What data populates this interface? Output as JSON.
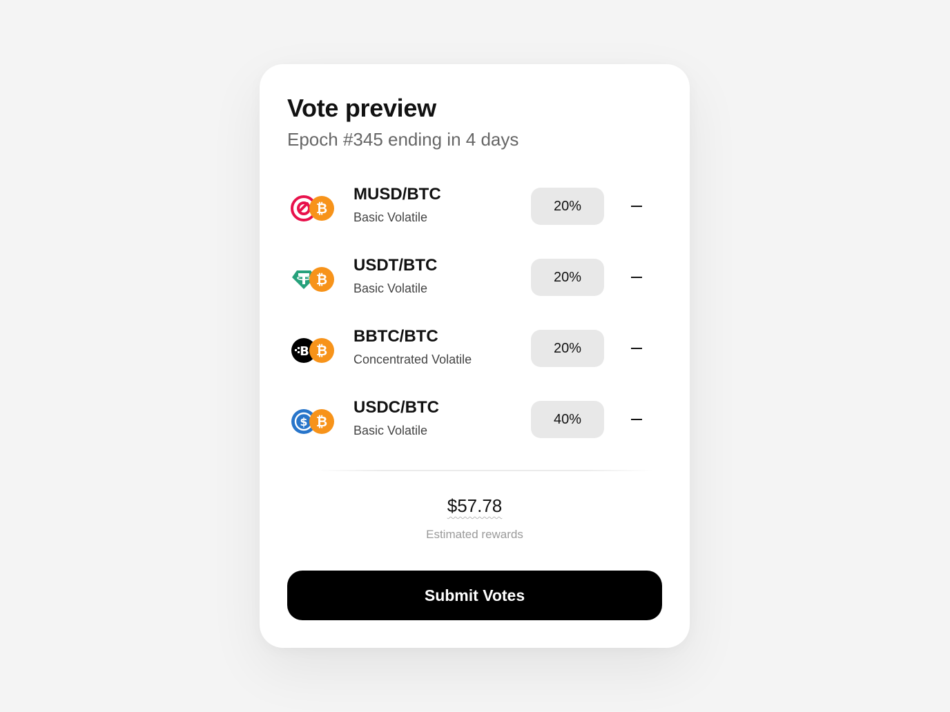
{
  "card": {
    "title": "Vote preview",
    "subtitle": "Epoch #345 ending in 4 days"
  },
  "pools": [
    {
      "pair": "MUSD/BTC",
      "type": "Basic Volatile",
      "weight": "20%",
      "token_icon": "musd-icon",
      "base_icon": "bitcoin-icon"
    },
    {
      "pair": "USDT/BTC",
      "type": "Basic Volatile",
      "weight": "20%",
      "token_icon": "tether-icon",
      "base_icon": "bitcoin-icon"
    },
    {
      "pair": "BBTC/BTC",
      "type": "Concentrated Volatile",
      "weight": "20%",
      "token_icon": "bbtc-icon",
      "base_icon": "bitcoin-icon"
    },
    {
      "pair": "USDC/BTC",
      "type": "Basic Volatile",
      "weight": "40%",
      "token_icon": "usdc-icon",
      "base_icon": "bitcoin-icon"
    }
  ],
  "rewards": {
    "value": "$57.78",
    "label": "Estimated rewards"
  },
  "actions": {
    "submit_label": "Submit Votes"
  },
  "colors": {
    "bitcoin": "#F7931A",
    "musd": "#E8114B",
    "tether": "#26A17B",
    "usdc": "#2775CA",
    "button": "#000000",
    "pill": "#E8E8E8"
  }
}
